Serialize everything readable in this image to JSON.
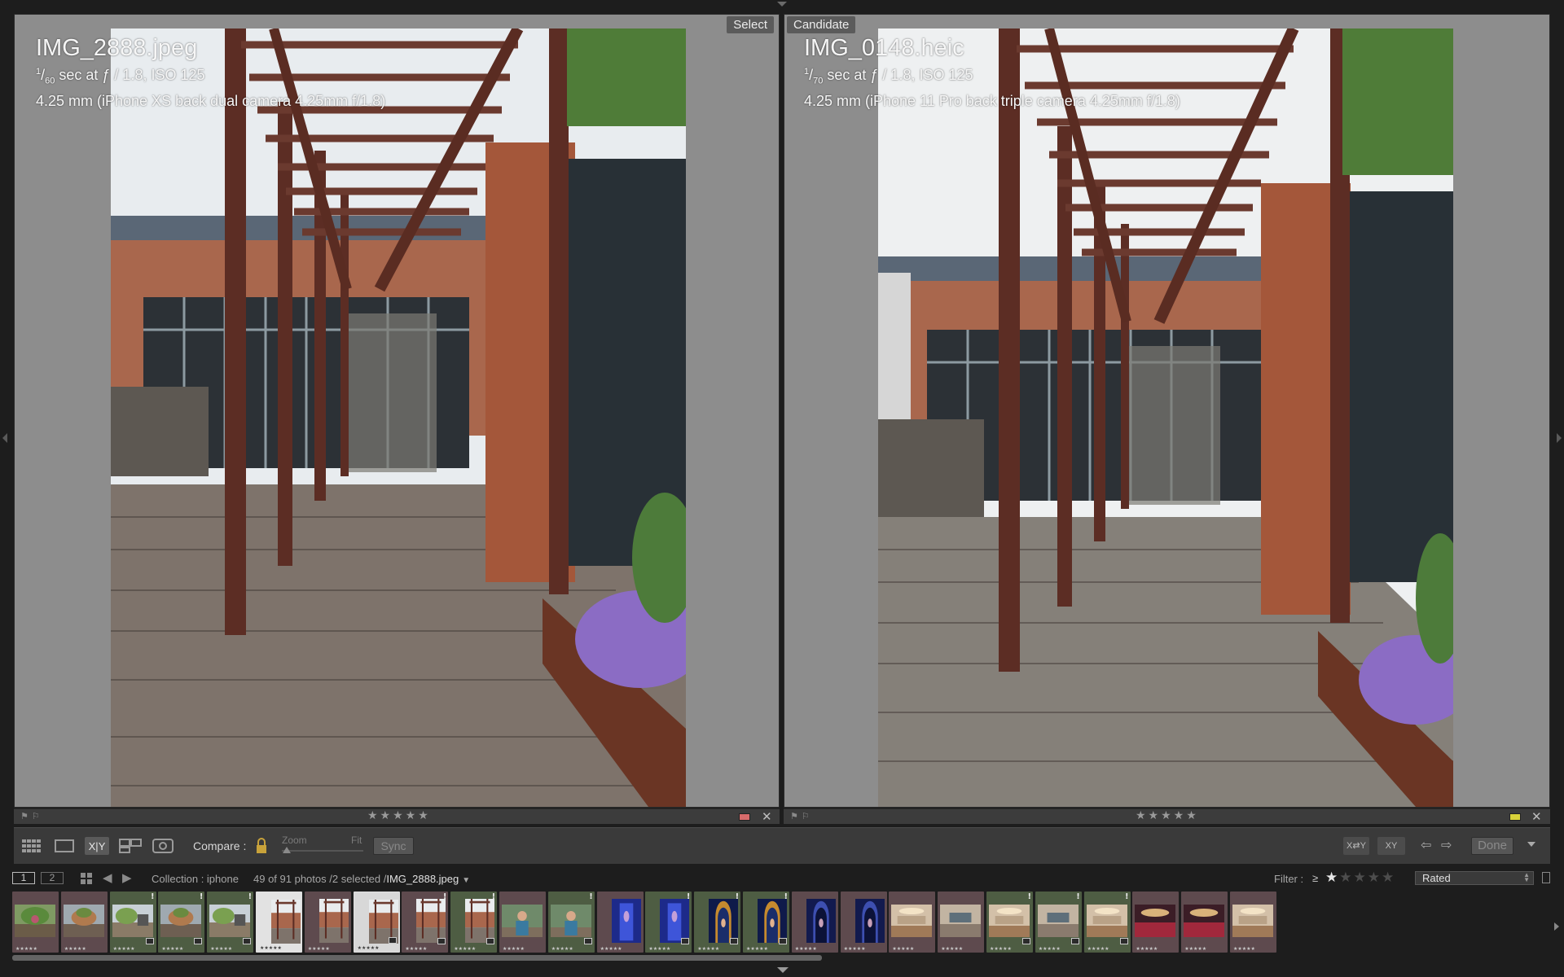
{
  "compare": {
    "select": {
      "tag": "Select",
      "filename": "IMG_2888.jpeg",
      "exposure_num": "1",
      "exposure_den": "60",
      "exposure_rest": " sec at ƒ / 1.8, ISO 125",
      "lens": "4.25 mm (iPhone XS back dual camera 4.25mm f/1.8)",
      "stars": "★★★★★",
      "label_color": "#d76b6b"
    },
    "candidate": {
      "tag": "Candidate",
      "filename": "IMG_0148.heic",
      "exposure_num": "1",
      "exposure_den": "70",
      "exposure_rest": " sec at ƒ / 1.8, ISO 125",
      "lens": "4.25 mm (iPhone 11 Pro back triple camera 4.25mm f/1.8)",
      "stars": "★★★★★",
      "label_color": "#d8d23a"
    }
  },
  "toolbar": {
    "compare_label": "Compare :",
    "zoom_label": "Zoom",
    "fit_label": "Fit",
    "sync_label": "Sync",
    "xy_label": "X|Y",
    "swap_label": "X⇄Y",
    "make_select_label": "XY",
    "done_label": "Done",
    "prev_icon": "left-arrow-icon",
    "next_icon": "right-arrow-icon"
  },
  "filmstrip_header": {
    "screen1": "1",
    "screen2": "2",
    "collection": "Collection : iphone",
    "count": "49 of 91 photos /2 selected /",
    "current_file": "IMG_2888.jpeg",
    "filter_label": "Filter :",
    "filter_op": "≥",
    "filter_rating": 1,
    "filter_mode": "Rated"
  },
  "filmstrip": {
    "thumbnails": [
      {
        "color": "#5e4a4e",
        "scene": "garden",
        "badge": false,
        "excl": false
      },
      {
        "color": "#5e4a4e",
        "scene": "garden2",
        "badge": false,
        "excl": false
      },
      {
        "color": "#4e5d43",
        "scene": "garden3",
        "badge": true,
        "excl": true
      },
      {
        "color": "#4e5d43",
        "scene": "garden2",
        "badge": true,
        "excl": true
      },
      {
        "color": "#4e5d43",
        "scene": "garden3",
        "badge": true,
        "excl": true
      },
      {
        "color": "#e2e2e2",
        "scene": "pergola",
        "badge": false,
        "excl": false,
        "selected": true
      },
      {
        "color": "#5e4a4e",
        "scene": "pergola",
        "badge": false,
        "excl": false
      },
      {
        "color": "#d8d8d8",
        "scene": "pergola",
        "badge": true,
        "excl": false,
        "selected": true
      },
      {
        "color": "#5e4a4e",
        "scene": "pergola",
        "badge": true,
        "excl": true
      },
      {
        "color": "#4e5d43",
        "scene": "pergola",
        "badge": true,
        "excl": true
      },
      {
        "color": "#5e4a4e",
        "scene": "person",
        "badge": false,
        "excl": false
      },
      {
        "color": "#4e5d43",
        "scene": "person",
        "badge": true,
        "excl": true
      },
      {
        "color": "#5e4a4e",
        "scene": "blue",
        "badge": false,
        "excl": false
      },
      {
        "color": "#4e5d43",
        "scene": "blue",
        "badge": true,
        "excl": true
      },
      {
        "color": "#4e5d43",
        "scene": "arch",
        "badge": true,
        "excl": true
      },
      {
        "color": "#4e5d43",
        "scene": "arch",
        "badge": true,
        "excl": true
      },
      {
        "color": "#5e4a4e",
        "scene": "arch2",
        "badge": false,
        "excl": false
      },
      {
        "color": "#5e4a4e",
        "scene": "arch2",
        "badge": false,
        "excl": false
      },
      {
        "color": "#5e4a4e",
        "scene": "room",
        "badge": false,
        "excl": false
      },
      {
        "color": "#5e4a4e",
        "scene": "room2",
        "badge": false,
        "excl": false
      },
      {
        "color": "#4e5d43",
        "scene": "room",
        "badge": true,
        "excl": true
      },
      {
        "color": "#4e5d43",
        "scene": "room2",
        "badge": true,
        "excl": true
      },
      {
        "color": "#4e5d43",
        "scene": "room",
        "badge": true,
        "excl": true
      },
      {
        "color": "#5e4a4e",
        "scene": "red",
        "badge": false,
        "excl": false
      },
      {
        "color": "#5e4a4e",
        "scene": "red",
        "badge": false,
        "excl": false
      },
      {
        "color": "#5e4a4e",
        "scene": "room",
        "badge": false,
        "excl": false
      }
    ]
  }
}
